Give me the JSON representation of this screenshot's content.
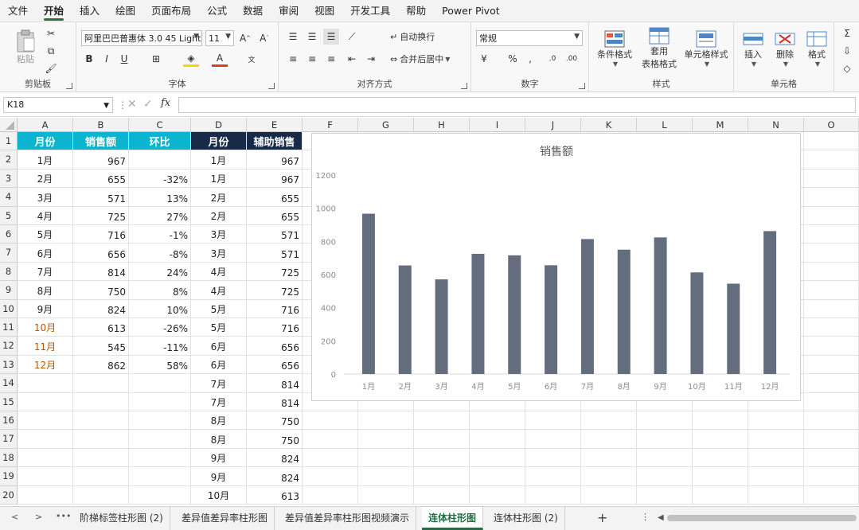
{
  "menu": [
    "文件",
    "开始",
    "插入",
    "绘图",
    "页面布局",
    "公式",
    "数据",
    "审阅",
    "视图",
    "开发工具",
    "帮助",
    "Power Pivot"
  ],
  "ribbon": {
    "clipboard": {
      "label": "剪贴板",
      "paste": "粘贴"
    },
    "font": {
      "label": "字体",
      "font_name": "阿里巴巴普惠体 3.0 45 Light",
      "font_size": "11"
    },
    "align": {
      "label": "对齐方式",
      "wrap": "自动换行",
      "merge": "合并后居中"
    },
    "number": {
      "label": "数字",
      "format": "常规"
    },
    "styles": {
      "label": "样式",
      "cond": "条件格式",
      "table1": "套用",
      "table2": "表格格式",
      "cell": "单元格样式"
    },
    "cells": {
      "label": "单元格",
      "insert": "插入",
      "delete": "删除",
      "format": "格式"
    }
  },
  "namebox": "K18",
  "columns": [
    "A",
    "B",
    "C",
    "D",
    "E",
    "F",
    "G",
    "H",
    "I",
    "J",
    "K",
    "L",
    "M",
    "N",
    "O"
  ],
  "rows": [
    "1",
    "2",
    "3",
    "4",
    "5",
    "6",
    "7",
    "8",
    "9",
    "10",
    "11",
    "12",
    "13",
    "14",
    "15",
    "16",
    "17",
    "18",
    "19",
    "20"
  ],
  "left_table": {
    "headers": [
      "月份",
      "销售额",
      "环比"
    ],
    "rows": [
      [
        "1月",
        "967",
        ""
      ],
      [
        "2月",
        "655",
        "-32%"
      ],
      [
        "3月",
        "571",
        "13%"
      ],
      [
        "4月",
        "725",
        "27%"
      ],
      [
        "5月",
        "716",
        "-1%"
      ],
      [
        "6月",
        "656",
        "-8%"
      ],
      [
        "7月",
        "814",
        "24%"
      ],
      [
        "8月",
        "750",
        "8%"
      ],
      [
        "9月",
        "824",
        "10%"
      ],
      [
        "10月",
        "613",
        "-26%"
      ],
      [
        "11月",
        "545",
        "-11%"
      ],
      [
        "12月",
        "862",
        "58%"
      ]
    ]
  },
  "right_table": {
    "headers": [
      "月份",
      "辅助销售"
    ],
    "rows": [
      [
        "1月",
        "967"
      ],
      [
        "1月",
        "967"
      ],
      [
        "2月",
        "655"
      ],
      [
        "2月",
        "655"
      ],
      [
        "3月",
        "571"
      ],
      [
        "3月",
        "571"
      ],
      [
        "4月",
        "725"
      ],
      [
        "4月",
        "725"
      ],
      [
        "5月",
        "716"
      ],
      [
        "5月",
        "716"
      ],
      [
        "6月",
        "656"
      ],
      [
        "6月",
        "656"
      ],
      [
        "7月",
        "814"
      ],
      [
        "7月",
        "814"
      ],
      [
        "8月",
        "750"
      ],
      [
        "8月",
        "750"
      ],
      [
        "9月",
        "824"
      ],
      [
        "9月",
        "824"
      ],
      [
        "10月",
        "613"
      ]
    ]
  },
  "colors": {
    "header_cyan": "#0bb5cf",
    "header_navy": "#172a48",
    "bar": "#646d7e",
    "accent": "#217346"
  },
  "chart_data": {
    "type": "bar",
    "title": "销售额",
    "categories": [
      "1月",
      "2月",
      "3月",
      "4月",
      "5月",
      "6月",
      "7月",
      "8月",
      "9月",
      "10月",
      "11月",
      "12月"
    ],
    "values": [
      967,
      655,
      571,
      725,
      716,
      656,
      814,
      750,
      824,
      613,
      545,
      862
    ],
    "ylim": [
      0,
      1200
    ],
    "yticks": [
      "0",
      "200",
      "400",
      "600",
      "800",
      "1000",
      "1200"
    ],
    "grid": false,
    "legend": "none"
  },
  "sheet_tabs": [
    "阶梯标签柱形图 (2)",
    "差异值差异率柱形图",
    "差异值差异率柱形图视频演示",
    "连体柱形图",
    "连体柱形图 (2)"
  ],
  "active_tab": "连体柱形图",
  "add_sheet": "+"
}
